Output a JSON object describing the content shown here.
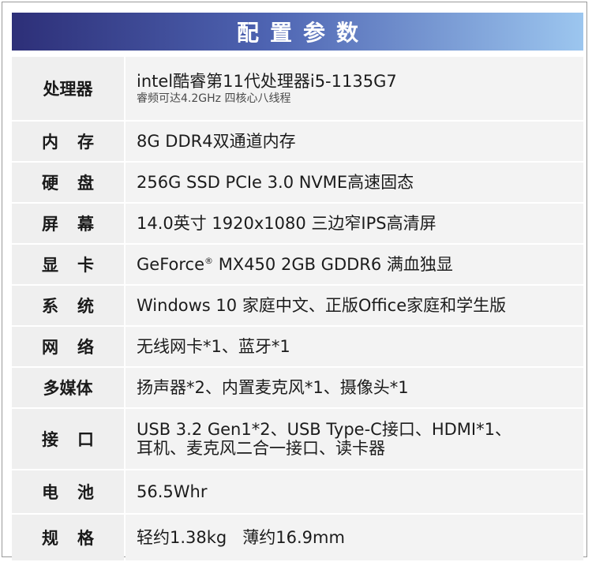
{
  "header": {
    "title": "配置参数"
  },
  "rows": [
    {
      "label": "处理器",
      "value": "intel酷睿第11代处理器i5-1135G7",
      "sub": "睿频可达4.2GHz 四核心八线程"
    },
    {
      "label": "内存",
      "value": "8G DDR4双通道内存"
    },
    {
      "label": "硬盘",
      "value": "256G SSD PCIe 3.0 NVME高速固态"
    },
    {
      "label": "屏幕",
      "value": "14.0英寸 1920x1080 三边窄IPS高清屏"
    },
    {
      "label": "显卡",
      "value_a": "GeForce",
      "reg": "®",
      "value_b": " MX450 2GB GDDR6 满血独显"
    },
    {
      "label": "系统",
      "value": "Windows 10 家庭中文、正版Office家庭和学生版"
    },
    {
      "label": "网络",
      "value": "无线网卡*1、蓝牙*1"
    },
    {
      "label": "多媒体",
      "value": "扬声器*2、内置麦克风*1、摄像头*1"
    },
    {
      "label": "接口",
      "value": "USB 3.2 Gen1*2、USB Type-C接口、HDMI*1、",
      "value2": "耳机、麦克风二合一接口、读卡器"
    },
    {
      "label": "电池",
      "value": "56.5Whr"
    },
    {
      "label": "规格",
      "value": "轻约1.38kg   薄约16.9mm"
    }
  ]
}
